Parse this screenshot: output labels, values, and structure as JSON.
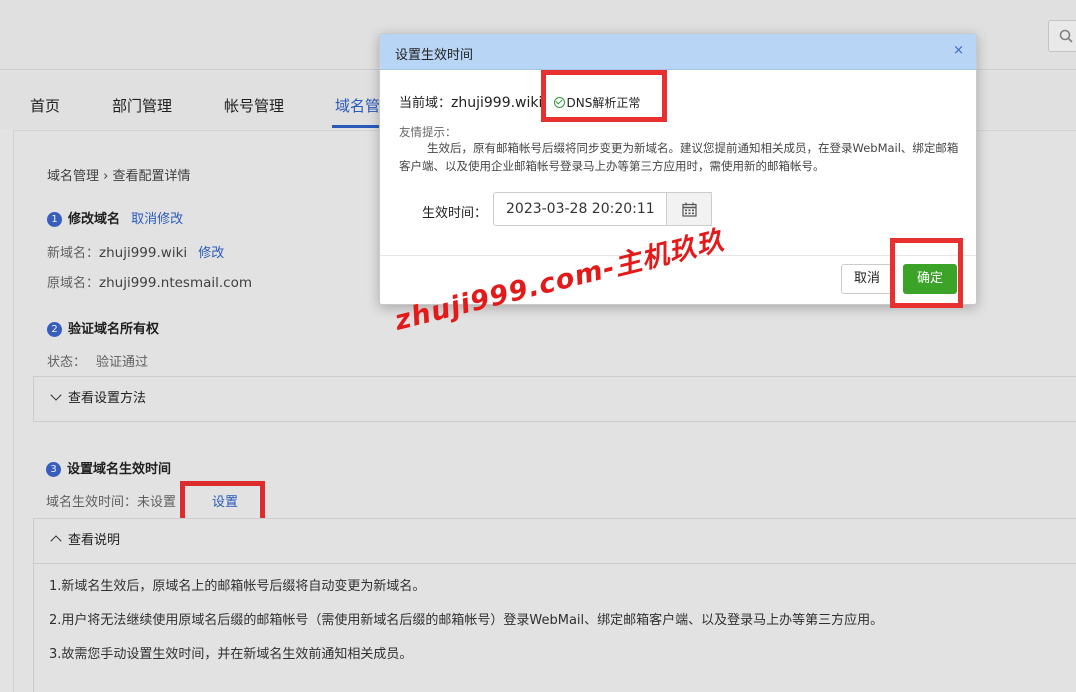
{
  "nav": {
    "items": [
      "首页",
      "部门管理",
      "帐号管理",
      "域名管"
    ]
  },
  "breadcrumb": "域名管理 › 查看配置详情",
  "step1": {
    "num": "1",
    "title": "修改域名",
    "cancel_link": "取消修改",
    "new_domain_label": "新域名：",
    "new_domain_value": "zhuji999.wiki",
    "edit_link": "修改",
    "old_domain_label": "原域名：",
    "old_domain_value": "zhuji999.ntesmail.com"
  },
  "step2": {
    "num": "2",
    "title": "验证域名所有权",
    "status_label": "状态：",
    "status_value": "验证通过",
    "collapse_label": "查看设置方法"
  },
  "step3": {
    "num": "3",
    "title": "设置域名生效时间",
    "time_label": "域名生效时间：",
    "time_value": "未设置",
    "set_link": "设置",
    "collapse_label": "查看说明",
    "notes": [
      "1.新域名生效后，原域名上的邮箱帐号后缀将自动变更为新域名。",
      "2.用户将无法继续使用原域名后缀的邮箱帐号（需使用新域名后缀的邮箱帐号）登录WebMail、绑定邮箱客户端、以及登录马上办等第三方应用。",
      "3.故需您手动设置生效时间，并在新域名生效前通知相关成员。"
    ]
  },
  "modal": {
    "title": "设置生效时间",
    "close": "×",
    "current_domain_label": "当前域：",
    "current_domain_value": "zhuji999.wiki",
    "dns_status": "DNS解析正常",
    "tip_title": "友情提示：",
    "tip_text": "生效后，原有邮箱帐号后缀将同步变更为新域名。建议您提前通知相关成员，在登录WebMail、绑定邮箱客户端、以及使用企业邮箱帐号登录马上办等第三方应用时，需使用新的邮箱帐号。",
    "effective_time_label": "生效时间：",
    "effective_time_value": "2023-03-28 20:20:11",
    "cancel_label": "取消",
    "confirm_label": "确定"
  },
  "watermark": "zhuji999.com-主机玖玖",
  "colors": {
    "accent_blue": "#2c5fc4",
    "confirm_green": "#3aa328",
    "highlight_red": "#e8302f",
    "modal_header": "#b8d5f5"
  }
}
